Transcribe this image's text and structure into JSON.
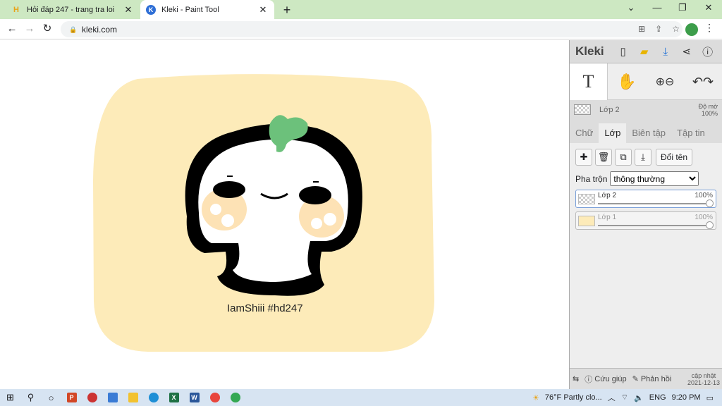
{
  "browser": {
    "tabs": [
      {
        "title": "Hỏi đáp 247 - trang tra loi",
        "favicon": "H"
      },
      {
        "title": "Kleki - Paint Tool",
        "favicon": "K"
      }
    ],
    "url": "kleki.com"
  },
  "canvas": {
    "caption": "IamShiii #hd247",
    "colors": {
      "background": "#fdebb9",
      "blush": "#fde2b5",
      "leaf": "#6cc17b",
      "outline": "#000000"
    }
  },
  "panel": {
    "logo": "Kleki",
    "current_layer": "Lớp 2",
    "opacity_label": "Độ mờ",
    "opacity_value": "100%",
    "tabs": [
      "Chữ",
      "Lớp",
      "Biên tập",
      "Tập tin"
    ],
    "rename_label": "Đổi tên",
    "blend_label": "Pha trộn",
    "blend_value": "thông thường",
    "layers": [
      {
        "name": "Lớp 2",
        "opacity": "100%"
      },
      {
        "name": "Lớp 1",
        "opacity": "100%"
      }
    ],
    "footer": {
      "help": "Cứu giúp",
      "feedback": "Phản hồi",
      "update_label": "cập nhật",
      "update_date": "2021-12-13"
    }
  },
  "taskbar": {
    "weather": "76°F  Partly clo...",
    "lang": "ENG",
    "time": "9:20 PM"
  }
}
